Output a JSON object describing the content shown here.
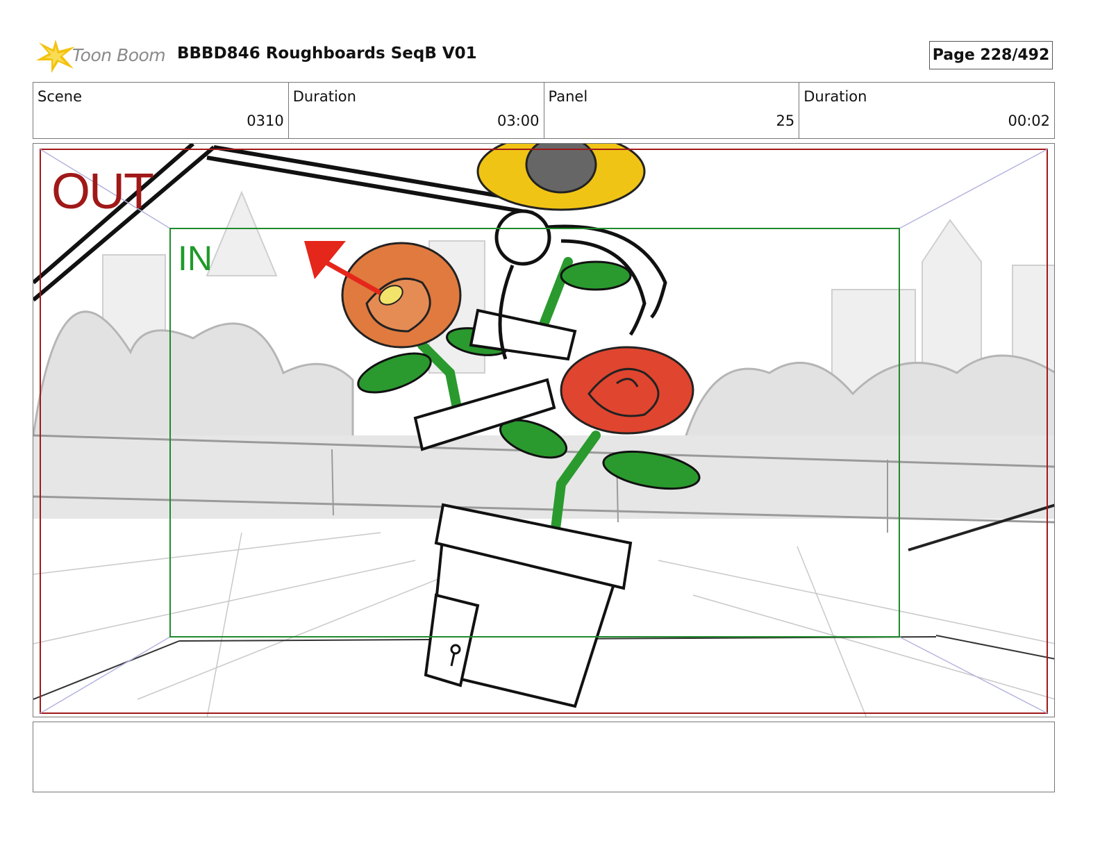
{
  "header": {
    "logo_text": "Toon Boom",
    "title": "BBBD846 Roughboards SeqB V01",
    "page": "Page 228/492"
  },
  "info": {
    "scene_label": "Scene",
    "scene_value": "0310",
    "scene_duration_label": "Duration",
    "scene_duration_value": "03:00",
    "panel_label": "Panel",
    "panel_value": "25",
    "panel_duration_label": "Duration",
    "panel_duration_value": "00:02"
  },
  "panel": {
    "out_label": "OUT",
    "in_label": "IN"
  },
  "caption": "",
  "colors": {
    "out_frame": "#a01818",
    "in_frame": "#1f8a2a",
    "leaf_green": "#2a9a2e",
    "sunflower": "#f0c415",
    "orange_flower": "#e07a3f",
    "red_rose": "#e0452f"
  }
}
